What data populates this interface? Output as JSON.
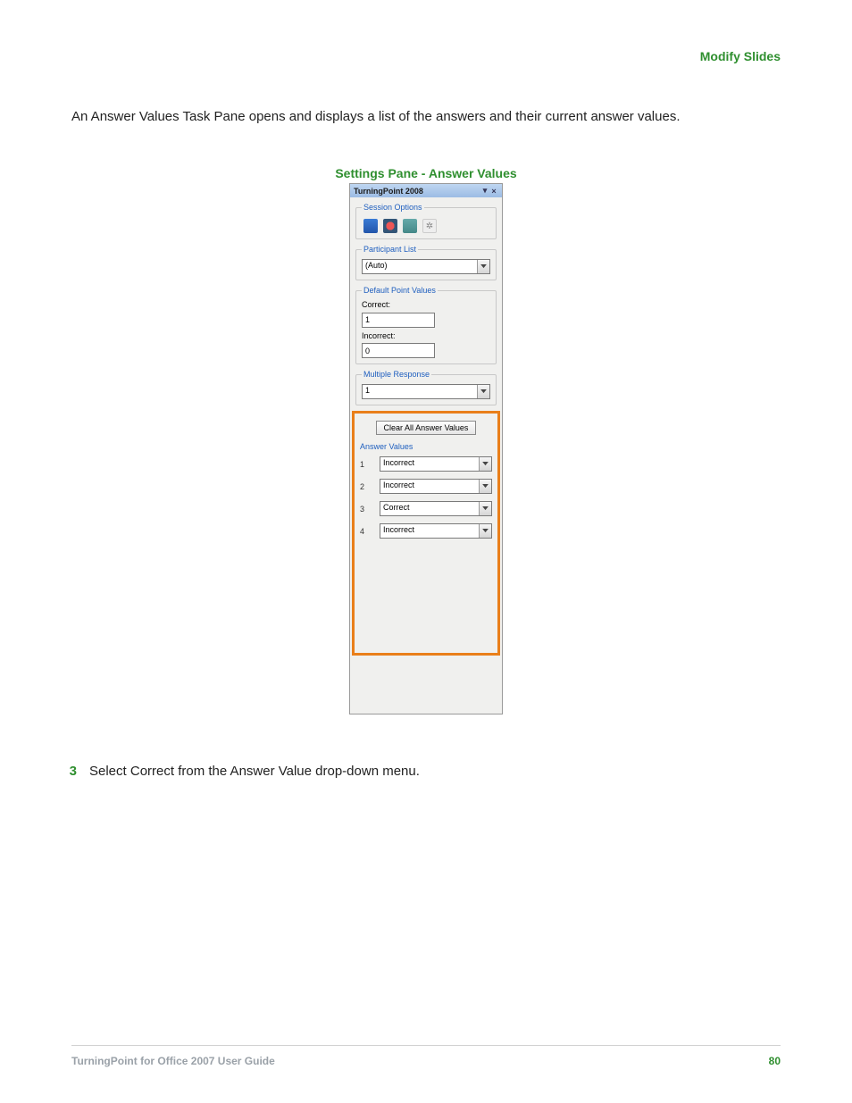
{
  "header": {
    "section_title": "Modify Slides"
  },
  "intro_text": "An Answer Values Task Pane opens and displays a list of the answers and their current answer values.",
  "figure_caption": "Settings Pane - Answer Values",
  "pane": {
    "title": "TurningPoint 2008",
    "titlebar_dropdown_glyph": "▾",
    "titlebar_close_glyph": "×",
    "session_options_legend": "Session Options",
    "icons": {
      "chart": "chart-icon",
      "pie": "pie-icon",
      "grid": "grid-icon",
      "gear": "gear-icon"
    },
    "participant_list_legend": "Participant List",
    "participant_list_value": "(Auto)",
    "default_point_values_legend": "Default Point Values",
    "correct_label": "Correct:",
    "correct_value": "1",
    "incorrect_label": "Incorrect:",
    "incorrect_value": "0",
    "multiple_response_legend": "Multiple Response",
    "multiple_response_value": "1",
    "clear_button_label": "Clear All Answer Values",
    "answer_values_legend": "Answer Values",
    "answer_rows": [
      {
        "num": "1",
        "value": "Incorrect"
      },
      {
        "num": "2",
        "value": "Incorrect"
      },
      {
        "num": "3",
        "value": "Correct"
      },
      {
        "num": "4",
        "value": "Incorrect"
      }
    ]
  },
  "step": {
    "number": "3",
    "text": "Select Correct from the Answer Value drop-down menu."
  },
  "footer": {
    "guide_title": "TurningPoint for Office 2007 User Guide",
    "page_number": "80"
  }
}
